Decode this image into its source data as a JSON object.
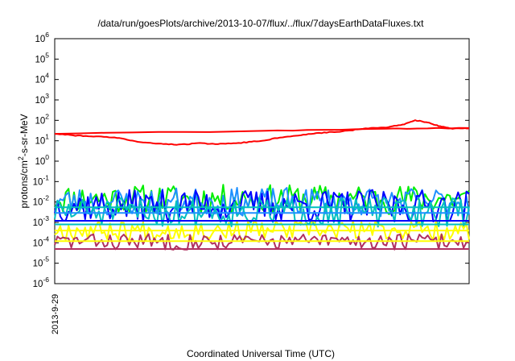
{
  "chart_data": {
    "type": "line",
    "title": "/data/run/goesPlots/archive/2013-10-07/flux/../flux/7daysEarthDataFluxes.txt",
    "xlabel": "Coordinated Universal Time (UTC)",
    "ylabel": {
      "prefix": "protons/cm",
      "superscript": "2",
      "suffix": "-s-sr-MeV"
    },
    "yscale": "log",
    "ylim": [
      1e-06,
      1000000.0
    ],
    "x_tick_labels": [
      "2013-9-29"
    ],
    "y_ticks": [
      {
        "base": "10",
        "exp": "6",
        "value": 1000000.0
      },
      {
        "base": "10",
        "exp": "5",
        "value": 100000.0
      },
      {
        "base": "10",
        "exp": "4",
        "value": 10000.0
      },
      {
        "base": "10",
        "exp": "3",
        "value": 1000.0
      },
      {
        "base": "10",
        "exp": "2",
        "value": 100.0
      },
      {
        "base": "10",
        "exp": "1",
        "value": 10.0
      },
      {
        "base": "10",
        "exp": "0",
        "value": 1.0
      },
      {
        "base": "10",
        "exp": "-1",
        "value": 0.1
      },
      {
        "base": "10",
        "exp": "-2",
        "value": 0.01
      },
      {
        "base": "10",
        "exp": "-3",
        "value": 0.001
      },
      {
        "base": "10",
        "exp": "-4",
        "value": 0.0001
      },
      {
        "base": "10",
        "exp": "-5",
        "value": 1e-05
      },
      {
        "base": "10",
        "exp": "-6",
        "value": 1e-06
      }
    ],
    "x_range_fraction": [
      0,
      1
    ],
    "series": [
      {
        "color": "#ff0000",
        "kind": "smooth",
        "points": [
          [
            0.0,
            22
          ],
          [
            0.05,
            18
          ],
          [
            0.1,
            16
          ],
          [
            0.15,
            14
          ],
          [
            0.2,
            9
          ],
          [
            0.25,
            7
          ],
          [
            0.3,
            6.5
          ],
          [
            0.35,
            7.5
          ],
          [
            0.4,
            7
          ],
          [
            0.45,
            8
          ],
          [
            0.5,
            10
          ],
          [
            0.55,
            15
          ],
          [
            0.6,
            20
          ],
          [
            0.65,
            25
          ],
          [
            0.7,
            30
          ],
          [
            0.75,
            40
          ],
          [
            0.8,
            45
          ],
          [
            0.84,
            60
          ],
          [
            0.87,
            100
          ],
          [
            0.9,
            80
          ],
          [
            0.93,
            50
          ],
          [
            0.96,
            40
          ],
          [
            1.0,
            40
          ]
        ]
      },
      {
        "color": "#ff0000",
        "kind": "smooth",
        "points": [
          [
            0.0,
            22
          ],
          [
            0.5,
            30
          ],
          [
            0.8,
            38
          ],
          [
            1.0,
            42
          ]
        ]
      },
      {
        "color": "#00ee00",
        "kind": "noise",
        "logmin": -2.6,
        "logmax": -1.15,
        "n": 150,
        "seed": 11
      },
      {
        "color": "#1e90ff",
        "kind": "noise",
        "logmin": -2.7,
        "logmax": -1.3,
        "n": 150,
        "seed": 23
      },
      {
        "color": "#0000ff",
        "kind": "noise",
        "logmin": -3.0,
        "logmax": -1.4,
        "n": 150,
        "seed": 37
      },
      {
        "color": "#00bfbf",
        "kind": "noise",
        "logmin": -3.25,
        "logmax": -1.8,
        "n": 150,
        "seed": 51
      },
      {
        "color": "#ffff00",
        "kind": "noise",
        "logmin": -3.9,
        "logmax": -2.9,
        "n": 150,
        "seed": 67
      },
      {
        "color": "#b03060",
        "kind": "noise",
        "logmin": -4.35,
        "logmax": -3.55,
        "n": 150,
        "seed": 83
      },
      {
        "color": "#00bfbf",
        "kind": "flat",
        "value": 0.0055
      },
      {
        "color": "#1e90ff",
        "kind": "flat",
        "value": 0.0029
      },
      {
        "color": "#0000ff",
        "kind": "flat",
        "value": 0.0012
      },
      {
        "color": "#00bfbf",
        "kind": "flat",
        "value": 0.0008
      },
      {
        "color": "#ffff00",
        "kind": "flat",
        "value": 0.0004
      },
      {
        "color": "#ffff00",
        "kind": "flat",
        "value": 0.00012
      },
      {
        "color": "#b03060",
        "kind": "flat",
        "value": 5e-05
      }
    ]
  }
}
